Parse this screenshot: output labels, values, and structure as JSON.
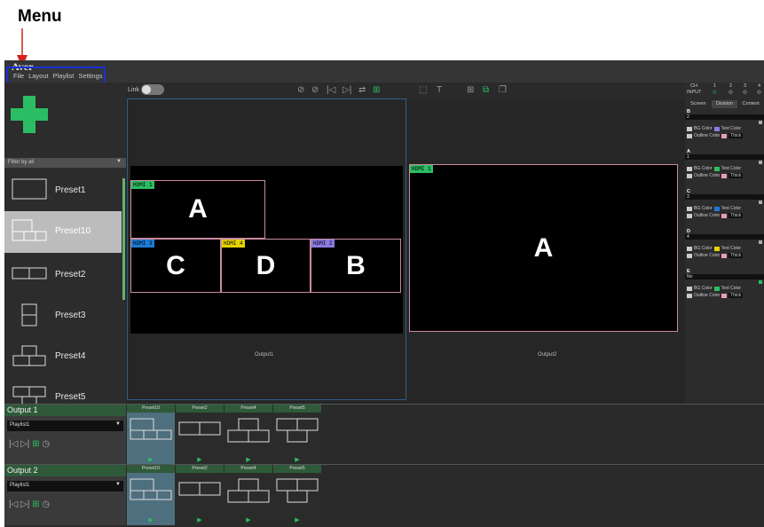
{
  "annotation": {
    "label": "Menu",
    "color": "#d62020"
  },
  "app": {
    "logo": "Aver"
  },
  "menu": {
    "items": [
      "File",
      "Layout",
      "Playlist",
      "Settings"
    ]
  },
  "filter": {
    "label": "Filter by all"
  },
  "presets": [
    {
      "label": "Preset1",
      "selected": false
    },
    {
      "label": "Preset10",
      "selected": true
    },
    {
      "label": "Preset2",
      "selected": false
    },
    {
      "label": "Preset3",
      "selected": false
    },
    {
      "label": "Preset4",
      "selected": false
    },
    {
      "label": "Preset5",
      "selected": false
    }
  ],
  "toolbar": {
    "link_label": "Link"
  },
  "output1": {
    "label": "Output1",
    "windows": [
      {
        "tag": "HDMI 1",
        "letter": "A",
        "tag_color": "#2bbd63"
      },
      {
        "tag": "HDMI 3",
        "letter": "C",
        "tag_color": "#1e7ad6"
      },
      {
        "tag": "HDMI 4",
        "letter": "D",
        "tag_color": "#e6d400"
      },
      {
        "tag": "HDMI 2",
        "letter": "B",
        "tag_color": "#8a7be0"
      }
    ]
  },
  "output2": {
    "label": "Output2",
    "windows": [
      {
        "tag": "HDMI 1",
        "letter": "A",
        "tag_color": "#2bbd63"
      }
    ]
  },
  "right_panel": {
    "ch_label": "CH",
    "input_label": "INPUT",
    "channels": [
      "1",
      "2",
      "3",
      "4"
    ],
    "tabs": [
      "Screen",
      "Division",
      "Content"
    ],
    "sections": [
      {
        "id": "B",
        "value": "2",
        "text_color": "#8a7be0"
      },
      {
        "id": "A",
        "value": "1",
        "text_color": "#2bbd63"
      },
      {
        "id": "C",
        "value": "3",
        "text_color": "#1e7ad6"
      },
      {
        "id": "D",
        "value": "4",
        "text_color": "#e6d400"
      },
      {
        "id": "E",
        "value": "No",
        "text_color": "#2bbd63"
      }
    ],
    "bg_color_label": "BG Color",
    "text_color_label": "Text Color",
    "outline_color_label": "Outline Color",
    "thick_label": "Thick"
  },
  "outputs_bottom": [
    {
      "title": "Output 1",
      "playlist": "Playlist1",
      "thumbs": [
        "Preset10",
        "Preset2",
        "Preset4",
        "Preset5"
      ]
    },
    {
      "title": "Output 2",
      "playlist": "Playlist1",
      "thumbs": [
        "Preset10",
        "Preset2",
        "Preset4",
        "Preset5"
      ]
    }
  ]
}
